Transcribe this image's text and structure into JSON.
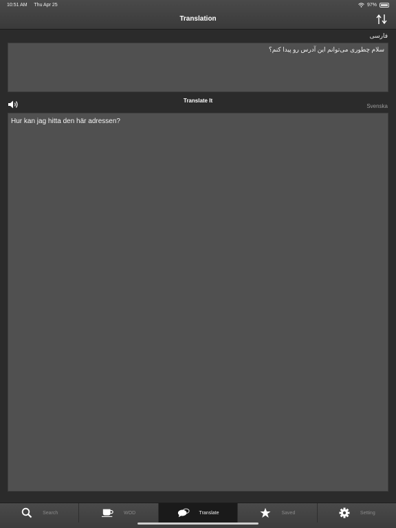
{
  "status": {
    "time": "10:51 AM",
    "date": "Thu Apr 25",
    "battery": "97%",
    "battery_level": 0.97
  },
  "nav": {
    "title": "Translation",
    "swap_icon": "swap-arrows-icon"
  },
  "source": {
    "language": "فارسی",
    "text": "سلام چطوری می‌توانم این آدرس رو پیدا کنم؟"
  },
  "actions": {
    "speaker_icon": "speaker-icon",
    "translate_label": "Translate It"
  },
  "target": {
    "language": "Svenska",
    "text": "Hur kan jag hitta den här adressen?"
  },
  "tabs": [
    {
      "label": "Search",
      "icon": "search-icon",
      "active": false
    },
    {
      "label": "WOD",
      "icon": "coffee-cup-icon",
      "active": false
    },
    {
      "label": "Translate",
      "icon": "speech-bubbles-icon",
      "active": true
    },
    {
      "label": "Saved",
      "icon": "star-icon",
      "active": false
    },
    {
      "label": "Setting",
      "icon": "gear-icon",
      "active": false
    }
  ]
}
